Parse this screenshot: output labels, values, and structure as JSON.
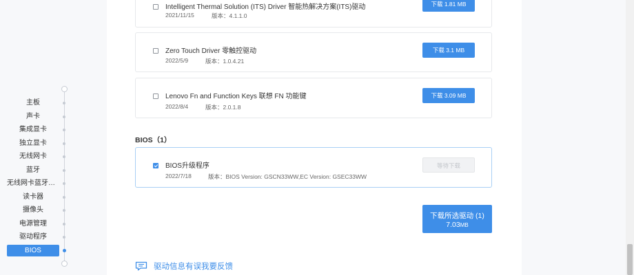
{
  "sidebar": {
    "items": [
      {
        "label": "主板"
      },
      {
        "label": "声卡"
      },
      {
        "label": "集成显卡"
      },
      {
        "label": "独立显卡"
      },
      {
        "label": "无线网卡"
      },
      {
        "label": "蓝牙"
      },
      {
        "label": "无线网卡蓝牙模块"
      },
      {
        "label": "读卡器"
      },
      {
        "label": "摄像头"
      },
      {
        "label": "电源管理"
      },
      {
        "label": "驱动程序"
      },
      {
        "label": "BIOS",
        "active": true
      }
    ]
  },
  "drivers": [
    {
      "name": "Intelligent Thermal Solution (ITS) Driver 智能热解决方案(ITS)驱动",
      "date": "2021/11/15",
      "version": "版本：4.1.1.0",
      "button": "下载 1.81 MB",
      "checked": false
    },
    {
      "name": "Zero Touch Driver 零触控驱动",
      "date": "2022/5/9",
      "version": "版本：1.0.4.21",
      "button": "下载 3.1 MB",
      "checked": false
    },
    {
      "name": "Lenovo Fn and Function Keys 联想 FN 功能键",
      "date": "2022/8/4",
      "version": "版本：2.0.1.8",
      "button": "下载 3.09 MB",
      "checked": false
    }
  ],
  "bios_section": {
    "title": "BIOS（1）",
    "item": {
      "name": "BIOS升级程序",
      "date": "2022/7/18",
      "version": "版本：BIOS Version: GSCN33WW,EC Version: GSEC33WW",
      "button": "等待下载",
      "checked": true
    }
  },
  "bulk_download": {
    "line1": "下载所选驱动 (1)",
    "size_value": "7.03",
    "size_unit": "MB"
  },
  "feedback": {
    "label": "驱动信息有误我要反馈"
  },
  "icons": {
    "feedback": "feedback-chat-icon",
    "checkbox": "checkbox-icon"
  },
  "colors": {
    "accent": "#3e8ee8",
    "background": "#f7f8fa"
  }
}
